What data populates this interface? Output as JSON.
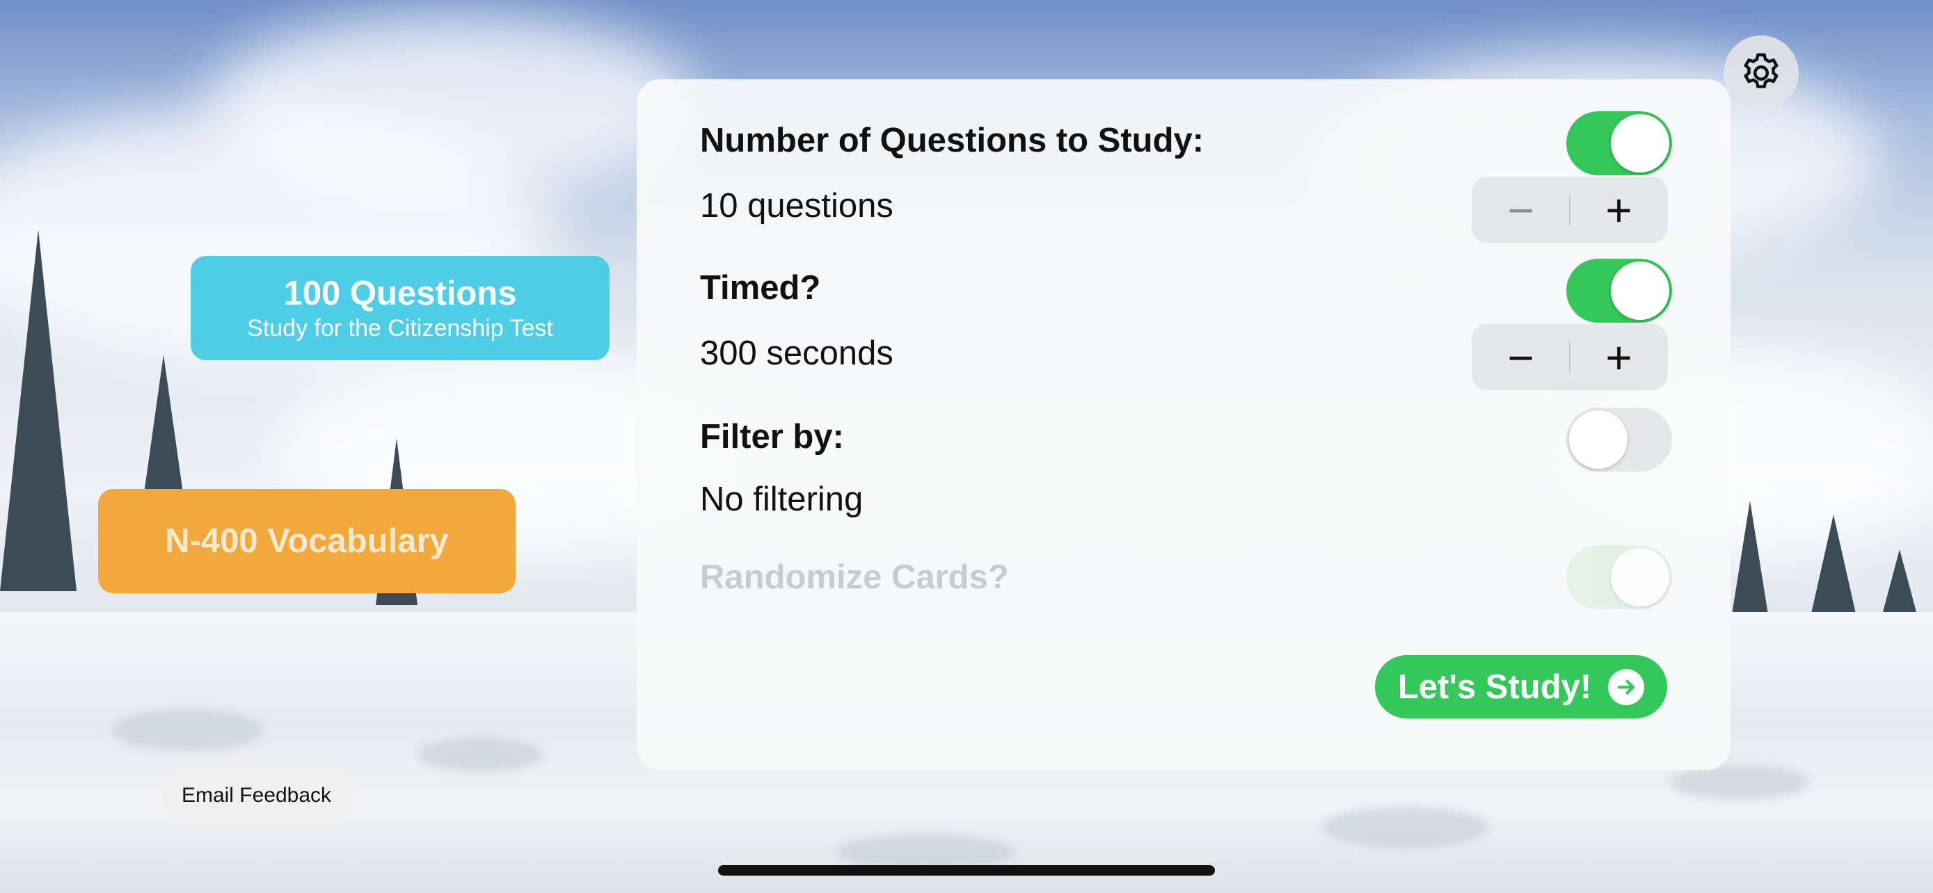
{
  "left_buttons": {
    "questions_title": "100 Questions",
    "questions_subtitle": "Study for the Citizenship Test",
    "vocabulary_label": "N-400 Vocabulary",
    "email_label": "Email Feedback"
  },
  "settings_icon": "gear-icon",
  "panel": {
    "num_questions_label": "Number of Questions to Study:",
    "num_questions_toggle": true,
    "num_questions_value": "10 questions",
    "timed_label": "Timed?",
    "timed_toggle": true,
    "timed_value": "300 seconds",
    "filter_label": "Filter by:",
    "filter_toggle": false,
    "filter_value": "No filtering",
    "randomize_label": "Randomize Cards?",
    "randomize_toggle": true,
    "randomize_enabled": false,
    "study_button_label": "Let's Study!",
    "stepper_minus": "−",
    "stepper_plus": "+"
  },
  "colors": {
    "green": "#34c759",
    "cyan_button": "#4dcde6",
    "orange_button": "#f0a93a"
  }
}
